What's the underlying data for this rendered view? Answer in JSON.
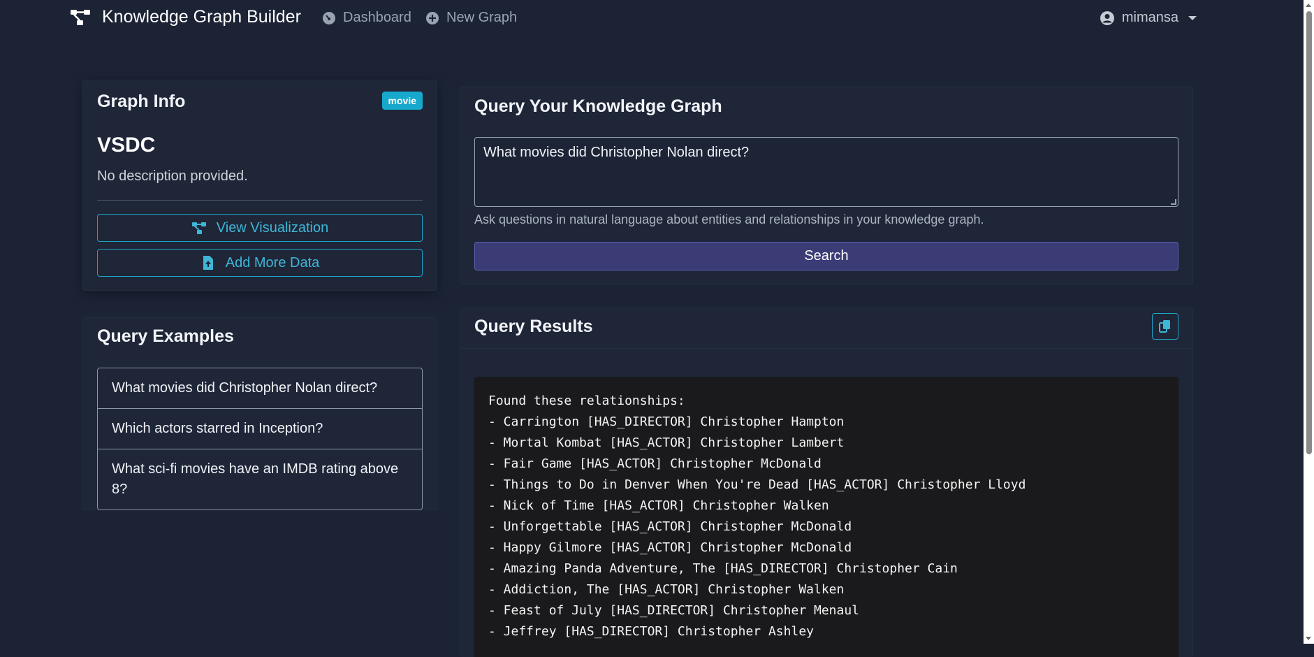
{
  "nav": {
    "brand": "Knowledge Graph Builder",
    "dashboard": "Dashboard",
    "new_graph": "New Graph",
    "user": "mimansa"
  },
  "graph_info": {
    "title": "Graph Info",
    "badge": "movie",
    "name": "VSDC",
    "description": "No description provided.",
    "view_button": "View Visualization",
    "add_button": "Add More Data"
  },
  "examples": {
    "title": "Query Examples",
    "items": [
      "What movies did Christopher Nolan direct?",
      "Which actors starred in Inception?",
      "What sci-fi movies have an IMDB rating above 8?"
    ]
  },
  "query": {
    "title": "Query Your Knowledge Graph",
    "value": "What movies did Christopher Nolan direct?",
    "help": "Ask questions in natural language about entities and relationships in your knowledge graph.",
    "search_button": "Search"
  },
  "results": {
    "title": "Query Results",
    "lines": [
      "Found these relationships:",
      "- Carrington [HAS_DIRECTOR] Christopher Hampton",
      "- Mortal Kombat [HAS_ACTOR] Christopher Lambert",
      "- Fair Game [HAS_ACTOR] Christopher McDonald",
      "- Things to Do in Denver When You're Dead [HAS_ACTOR] Christopher Lloyd",
      "- Nick of Time [HAS_ACTOR] Christopher Walken",
      "- Unforgettable [HAS_ACTOR] Christopher McDonald",
      "- Happy Gilmore [HAS_ACTOR] Christopher McDonald",
      "- Amazing Panda Adventure, The [HAS_DIRECTOR] Christopher Cain",
      "- Addiction, The [HAS_ACTOR] Christopher Walken",
      "- Feast of July [HAS_DIRECTOR] Christopher Menaul",
      "- Jeffrey [HAS_DIRECTOR] Christopher Ashley"
    ]
  },
  "colors": {
    "background": "#1b2335",
    "card": "#1e2638",
    "accent": "#17a9cc",
    "search_button": "#3b3c76"
  }
}
